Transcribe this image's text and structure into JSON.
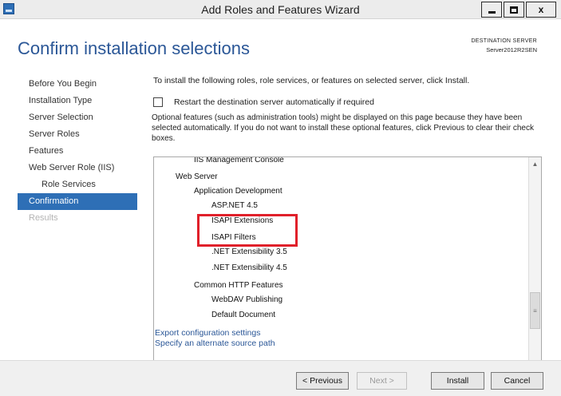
{
  "window": {
    "title": "Add Roles and Features Wizard",
    "minimize_icon": "minimize-icon",
    "maximize_icon": "maximize-icon",
    "close_glyph": "x"
  },
  "header": {
    "title": "Confirm installation selections",
    "destination_label": "DESTINATION SERVER",
    "destination_server": "Server2012R2SEN"
  },
  "sidebar": {
    "items": [
      {
        "label": "Before You Begin",
        "state": "normal"
      },
      {
        "label": "Installation Type",
        "state": "normal"
      },
      {
        "label": "Server Selection",
        "state": "normal"
      },
      {
        "label": "Server Roles",
        "state": "normal"
      },
      {
        "label": "Features",
        "state": "normal"
      },
      {
        "label": "Web Server Role (IIS)",
        "state": "normal"
      },
      {
        "label": "Role Services",
        "state": "normal"
      },
      {
        "label": "Confirmation",
        "state": "active"
      },
      {
        "label": "Results",
        "state": "disabled"
      }
    ]
  },
  "content": {
    "intro": "To install the following roles, role services, or features on selected server, click Install.",
    "restart_label": "Restart the destination server automatically if required",
    "restart_checked": false,
    "optional_text": "Optional features (such as administration tools) might be displayed on this page because they have been selected automatically. If you do not want to install these optional features, click Previous to clear their check boxes.",
    "features": [
      "IIS Management Console",
      "Web Server",
      "Application Development",
      "ASP.NET 4.5",
      "ISAPI Extensions",
      "ISAPI Filters",
      ".NET Extensibility 3.5",
      ".NET Extensibility 4.5",
      "Common HTTP Features",
      "WebDAV Publishing",
      "Default Document"
    ],
    "highlighted_items": [
      "ISAPI Extensions",
      "ISAPI Filters"
    ],
    "highlight_color": "#e0202a",
    "links": {
      "export": "Export configuration settings",
      "alternate_source": "Specify an alternate source path"
    }
  },
  "footer": {
    "previous": "< Previous",
    "next": "Next >",
    "install": "Install",
    "cancel": "Cancel"
  },
  "colors": {
    "accent": "#2e6fb6",
    "title": "#2b5797"
  }
}
